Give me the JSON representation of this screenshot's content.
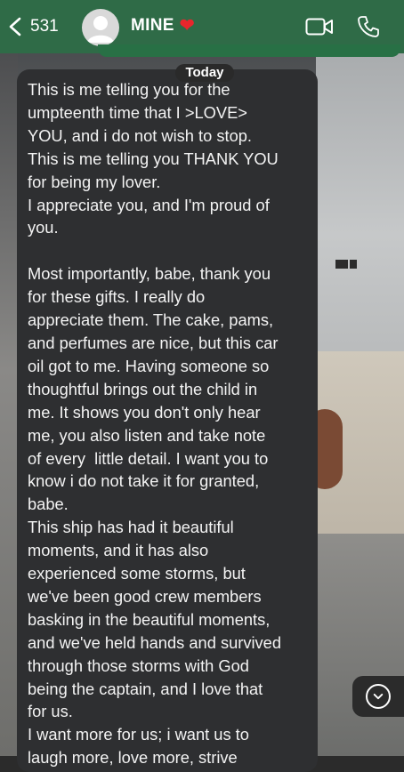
{
  "header": {
    "back_count": "531",
    "contact_name": "MINE",
    "heart": "❤️",
    "avatar_icon": "person-icon",
    "video_icon": "video-call-icon",
    "phone_icon": "phone-call-icon"
  },
  "chat": {
    "date_label": "Today",
    "message_lines": [
      "This is me telling you for the",
      "umpteenth time that I >LOVE>",
      "YOU, and i do not wish to stop.",
      "This is me telling you THANK YOU",
      "for being my lover.",
      "I appreciate you, and I'm proud of",
      "you.",
      "",
      "Most importantly, babe, thank you",
      "for these gifts. I really do",
      "appreciate them. The cake, pams,",
      "and perfumes are nice, but this car",
      "oil got to me. Having someone so",
      "thoughtful brings out the child in",
      "me. It shows you don't only hear",
      "me, you also listen and take note",
      "of every  little detail. I want you to",
      "know i do not take it for granted,",
      "babe.",
      "This ship has had it beautiful",
      "moments, and it has also",
      "experienced some storms, but",
      "we've been good crew members",
      "basking in the beautiful moments,",
      "and we've held hands and survived",
      "through those storms with God",
      "being the captain, and I love that",
      "for us.",
      "I want more for us; i want us to",
      "laugh more, love more, strive"
    ],
    "scroll_icon": "chevron-down-icon"
  },
  "colors": {
    "header_bg": "#2f6b47",
    "bubble_bg": "#2e2f31",
    "text": "#f3f3f3",
    "heart": "#e8262c"
  }
}
